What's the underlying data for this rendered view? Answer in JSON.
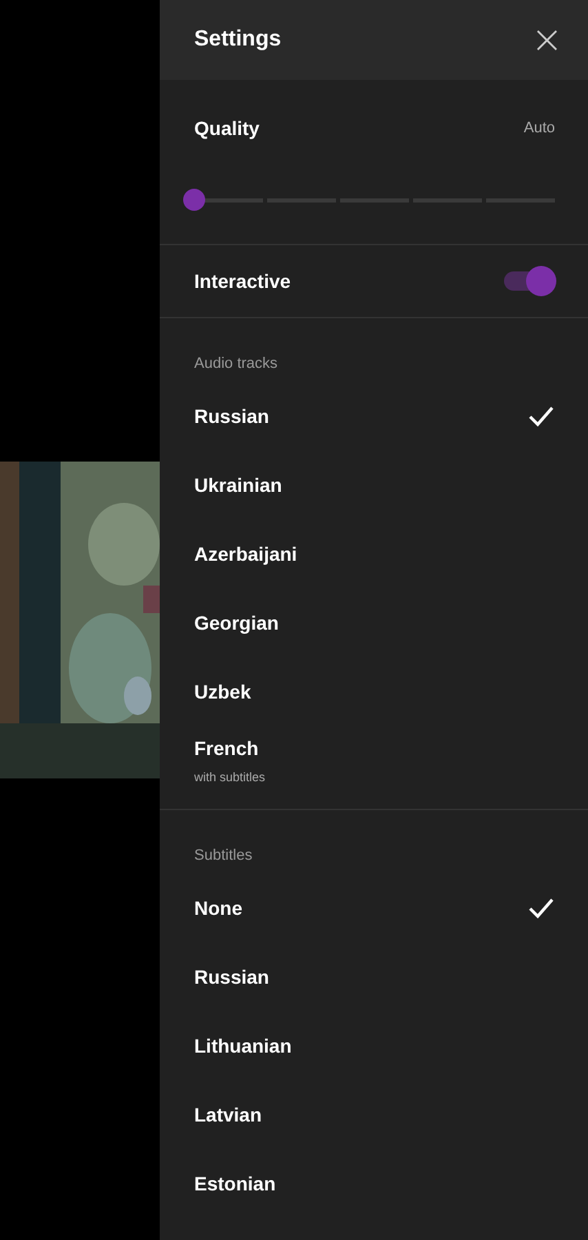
{
  "header": {
    "title": "Settings",
    "close_icon": "×"
  },
  "quality": {
    "label": "Quality",
    "value": "Auto",
    "level": 0
  },
  "interactive": {
    "label": "Interactive",
    "on": true
  },
  "audio_tracks": {
    "heading": "Audio tracks",
    "items": [
      {
        "label": "Russian",
        "selected": true
      },
      {
        "label": "Ukrainian",
        "selected": false
      },
      {
        "label": "Azerbaijani",
        "selected": false
      },
      {
        "label": "Georgian",
        "selected": false
      },
      {
        "label": "Uzbek",
        "selected": false
      },
      {
        "label": "French",
        "note": "with subtitles",
        "selected": false
      }
    ]
  },
  "subtitles": {
    "heading": "Subtitles",
    "items": [
      {
        "label": "None",
        "selected": true
      },
      {
        "label": "Russian",
        "selected": false
      },
      {
        "label": "Lithuanian",
        "selected": false
      },
      {
        "label": "Latvian",
        "selected": false
      },
      {
        "label": "Estonian",
        "selected": false
      }
    ]
  }
}
